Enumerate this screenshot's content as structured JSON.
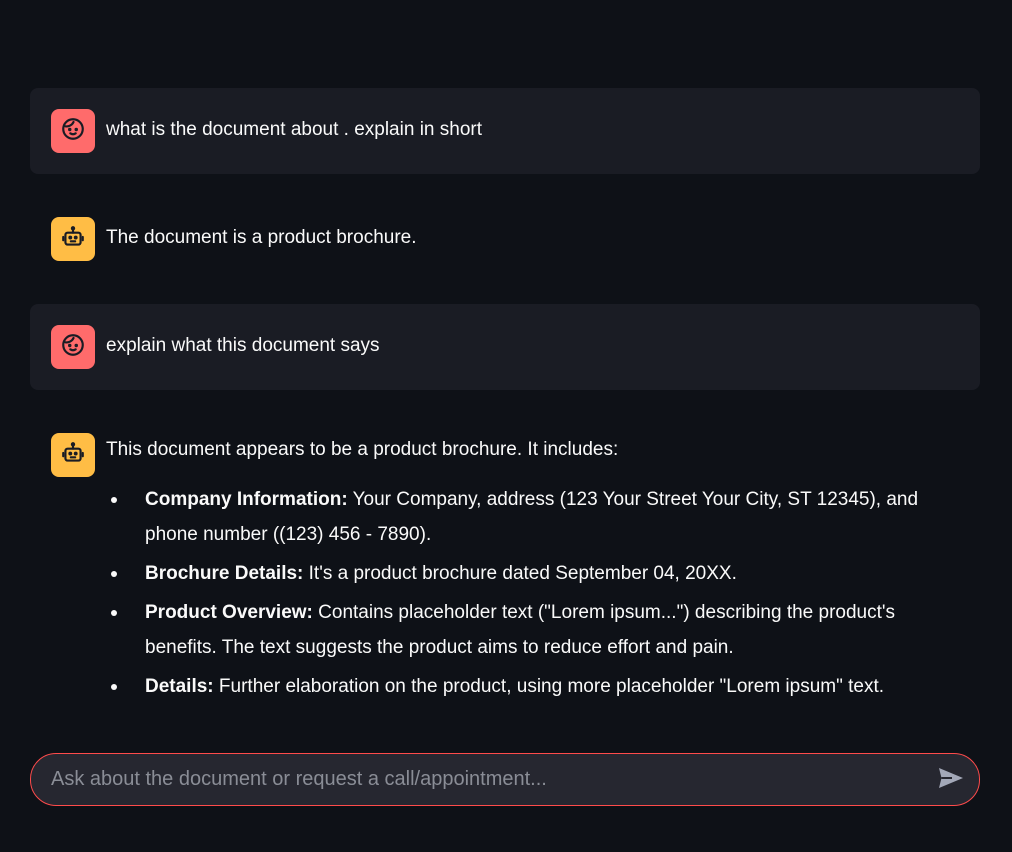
{
  "messages": [
    {
      "role": "user",
      "avatar_icon": "user-face-icon",
      "text": "what is the document about . explain in short"
    },
    {
      "role": "assistant",
      "avatar_icon": "robot-icon",
      "text": "The document is a product brochure."
    },
    {
      "role": "user",
      "avatar_icon": "user-face-icon",
      "text": "explain what this document says"
    },
    {
      "role": "assistant",
      "avatar_icon": "robot-icon",
      "intro": "This document appears to be a product brochure. It includes:",
      "points": [
        {
          "label": "Company Information:",
          "text": " Your Company, address (123 Your Street Your City, ST 12345), and phone number ((123) 456 - 7890)."
        },
        {
          "label": "Brochure Details:",
          "text": " It's a product brochure dated September 04, 20XX."
        },
        {
          "label": "Product Overview:",
          "text": " Contains placeholder text (\"Lorem ipsum...\") describing the product's benefits. The text suggests the product aims to reduce effort and pain."
        },
        {
          "label": "Details:",
          "text": " Further elaboration on the product, using more placeholder \"Lorem ipsum\" text."
        }
      ]
    }
  ],
  "chat_input": {
    "placeholder": "Ask about the document or request a call/appointment...",
    "value": "",
    "send_icon": "send-icon"
  },
  "colors": {
    "background": "#0e1117",
    "user_bubble": "#1a1c24",
    "user_avatar": "#ff6b6b",
    "bot_avatar": "#ffbd45",
    "input_border": "#ff4b4b"
  }
}
